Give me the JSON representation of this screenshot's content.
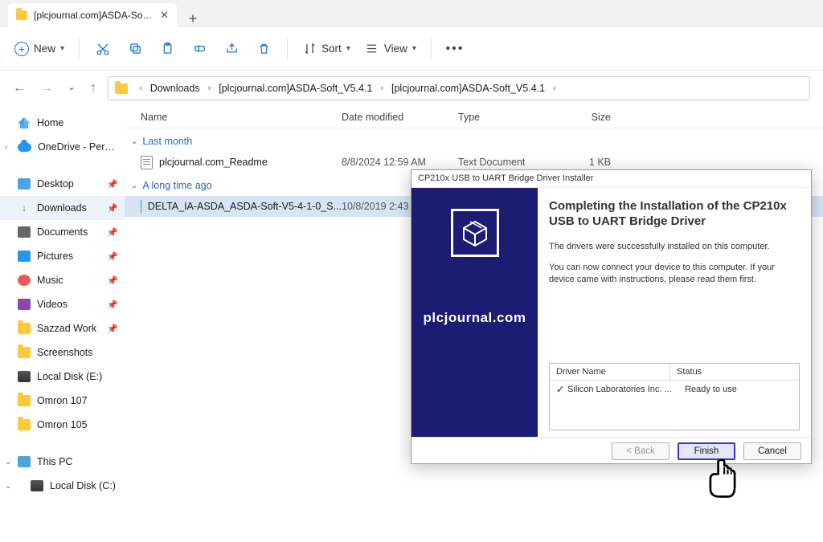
{
  "tab": {
    "title": "[plcjournal.com]ASDA-Soft_V5"
  },
  "toolbar": {
    "new": "New",
    "sort": "Sort",
    "view": "View"
  },
  "breadcrumb": {
    "items": [
      "Downloads",
      "[plcjournal.com]ASDA-Soft_V5.4.1",
      "[plcjournal.com]ASDA-Soft_V5.4.1"
    ]
  },
  "sidebar": {
    "top": [
      {
        "label": "Home",
        "icon": "home"
      },
      {
        "label": "OneDrive - Personal",
        "icon": "cloud",
        "caret": true
      }
    ],
    "quick": [
      {
        "label": "Desktop",
        "icon": "desktop",
        "pinned": true
      },
      {
        "label": "Downloads",
        "icon": "dl",
        "pinned": true,
        "selected": true
      },
      {
        "label": "Documents",
        "icon": "doc",
        "pinned": true
      },
      {
        "label": "Pictures",
        "icon": "pic",
        "pinned": true
      },
      {
        "label": "Music",
        "icon": "music",
        "pinned": true
      },
      {
        "label": "Videos",
        "icon": "vid",
        "pinned": true
      },
      {
        "label": "Sazzad Work",
        "icon": "folder",
        "pinned": true
      },
      {
        "label": "Screenshots",
        "icon": "folder"
      },
      {
        "label": "Local Disk (E:)",
        "icon": "drive"
      },
      {
        "label": "Omron 107",
        "icon": "folder"
      },
      {
        "label": "Omron 105",
        "icon": "folder"
      }
    ],
    "pc": [
      {
        "label": "This PC",
        "icon": "pc",
        "caret": true
      },
      {
        "label": "Local Disk (C:)",
        "icon": "drive",
        "caret": true,
        "indent": true
      }
    ]
  },
  "columns": {
    "name": "Name",
    "date": "Date modified",
    "type": "Type",
    "size": "Size"
  },
  "groups": [
    {
      "title": "Last month",
      "files": [
        {
          "name": "plcjournal.com_Readme",
          "date": "8/8/2024 12:59 AM",
          "type": "Text Document",
          "size": "1 KB",
          "icon": "txt"
        }
      ]
    },
    {
      "title": "A long time ago",
      "files": [
        {
          "name": "DELTA_IA-ASDA_ASDA-Soft-V5-4-1-0_S...",
          "date": "10/8/2019 2:43",
          "type": "",
          "size": "",
          "icon": "exe",
          "selected": true
        }
      ]
    }
  ],
  "dialog": {
    "title": "CP210x USB to UART Bridge Driver Installer",
    "heading": "Completing the Installation of the CP210x USB to UART Bridge Driver",
    "p1": "The drivers were successfully installed on this computer.",
    "p2": "You can now connect your device to this computer. If your device came with instructions, please read them first.",
    "watermark": "plcjournal.com",
    "table": {
      "h1": "Driver Name",
      "h2": "Status",
      "r1": "Silicon Laboratories Inc. ...",
      "r2": "Ready to use"
    },
    "buttons": {
      "back": "< Back",
      "finish": "Finish",
      "cancel": "Cancel"
    }
  }
}
